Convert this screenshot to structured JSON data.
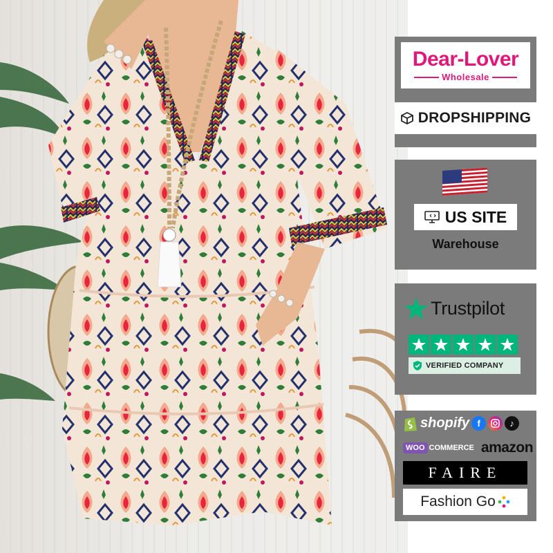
{
  "brand": {
    "name": "Dear-Lover",
    "subtitle": "Wholesale",
    "color": "#e0187c"
  },
  "dropshipping": {
    "label": "DROPSHIPPING",
    "icon": "box-icon"
  },
  "us_site": {
    "flag": "us-flag-icon",
    "label": "US SITE",
    "icon": "monitor-icon",
    "sublabel": "Warehouse"
  },
  "trustpilot": {
    "label": "Trustpilot",
    "stars": 5,
    "rating_max": 5,
    "verified_label": "VERIFIED COMPANY",
    "star_color": "#00b67a"
  },
  "platforms": {
    "shopify": "shopify",
    "social_icons": [
      "facebook-icon",
      "instagram-icon",
      "tiktok-icon"
    ],
    "woo": "WOO",
    "commerce": "COMMERCE",
    "amazon": "amazon",
    "faire": "FAIRE",
    "fashion_go": "Fashion Go"
  },
  "colors": {
    "panel": "#7b7b7b",
    "trustpilot_green": "#00b67a"
  }
}
